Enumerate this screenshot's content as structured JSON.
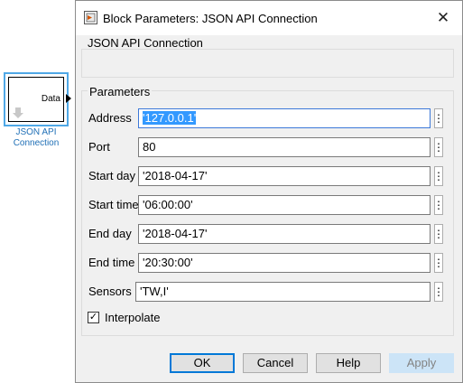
{
  "canvas": {
    "block": {
      "port_label": "Data",
      "name_line1": "JSON API",
      "name_line2": "Connection"
    }
  },
  "dialog": {
    "title": "Block Parameters: JSON API Connection",
    "close_glyph": "✕",
    "description_label": "JSON API Connection",
    "parameters_label": "Parameters",
    "fields": [
      {
        "label": "Address",
        "value": "'127.0.0.1'"
      },
      {
        "label": "Port",
        "value": "80"
      },
      {
        "label": "Start day",
        "value": "'2018-04-17'"
      },
      {
        "label": "Start time",
        "value": "'06:00:00'"
      },
      {
        "label": "End day",
        "value": "'2018-04-17'"
      },
      {
        "label": "End time",
        "value": "'20:30:00'"
      },
      {
        "label": "Sensors",
        "value": "'TW,I'"
      }
    ],
    "more_glyph": "⋮",
    "interpolate": {
      "label": "Interpolate",
      "checked": true,
      "check_glyph": "✓"
    },
    "buttons": {
      "ok": "OK",
      "cancel": "Cancel",
      "help": "Help",
      "apply": "Apply"
    }
  },
  "colors": {
    "selection": "#3399ff",
    "block_name": "#1f6fb6",
    "focus_border": "#0078d7"
  },
  "icons": [
    "simulink-block-icon",
    "close-icon",
    "more-options-icon",
    "checkbox-checked-icon",
    "port-arrow-icon",
    "down-arrow-icon"
  ]
}
